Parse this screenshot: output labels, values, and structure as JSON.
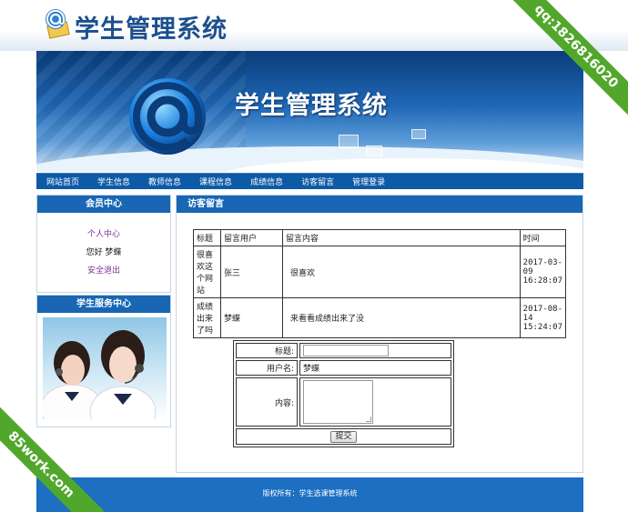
{
  "header": {
    "title": "学生管理系统"
  },
  "banner": {
    "title": "学生管理系统"
  },
  "nav": {
    "items": [
      "网站首页",
      "学生信息",
      "教师信息",
      "课程信息",
      "成绩信息",
      "访客留言",
      "管理登录"
    ]
  },
  "member_center": {
    "title": "会员中心",
    "profile_link": "个人中心",
    "greeting": "您好 梦蝶",
    "logout_link": "安全退出"
  },
  "service_center": {
    "title": "学生服务中心"
  },
  "guestbook": {
    "title": "访客留言",
    "columns": [
      "标题",
      "留言用户",
      "留言内容",
      "时间"
    ],
    "rows": [
      {
        "title": "很喜欢这个网站",
        "user": "张三",
        "content": "很喜欢",
        "time": "2017-03-09 16:28:07"
      },
      {
        "title": "成绩出来了吗",
        "user": "梦蝶",
        "content": "来看看成绩出来了没",
        "time": "2017-08-14 15:24:07"
      }
    ],
    "form": {
      "title_label": "标题:",
      "title_value": "",
      "user_label": "用户名:",
      "user_value": "梦蝶",
      "content_label": "内容:",
      "content_value": "",
      "submit_label": "提交"
    }
  },
  "footer": {
    "text": "版权所有：学生选课管理系统"
  },
  "watermarks": {
    "top_right": "qq:1826816020",
    "bottom_left": "85work.com"
  },
  "colors": {
    "brand_blue": "#1866b4",
    "nav_blue": "#0d5aa7",
    "ribbon_green": "#51a72c",
    "link_purple": "#7a2f9a"
  }
}
